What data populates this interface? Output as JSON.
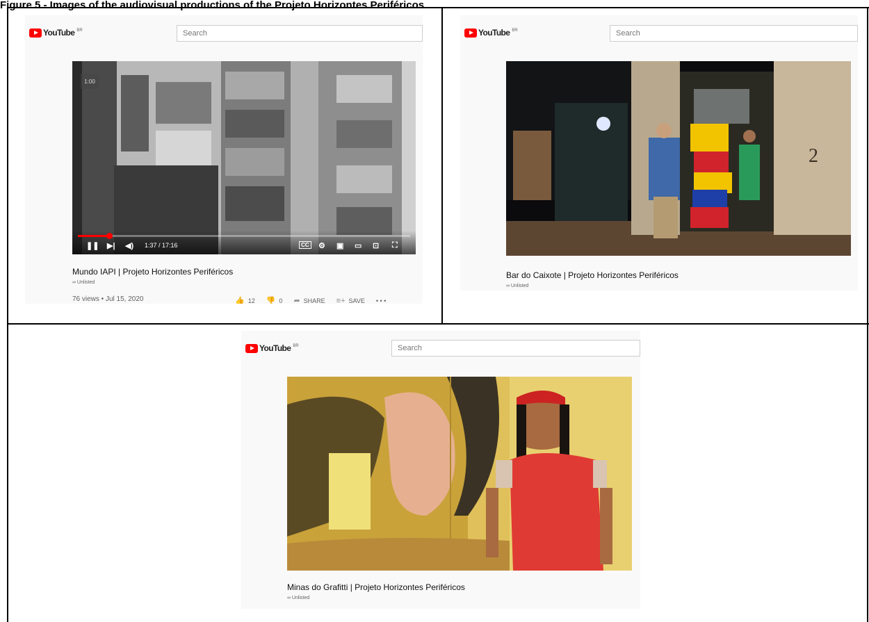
{
  "figure_label": "Figure 5 - Images of the audiovisual productions of the Projeto Horizontes Periféricos",
  "youtube": {
    "logo_text": "YouTube",
    "region": "BR",
    "search_placeholder": "Search",
    "brand_color": "#ff0000"
  },
  "videos": [
    {
      "title": "Mundo IAPI | Projeto Horizontes Periféricos",
      "badge": "∞ Unlisted",
      "views_date": "76 views • Jul 15, 2020",
      "player": {
        "overlay_time": "1:00",
        "current_time": "1:37",
        "duration": "17:16",
        "time_display": "1:37 / 17:16",
        "progress_fraction": 0.094
      },
      "actions": {
        "likes": "12",
        "dislikes": "0",
        "share": "SHARE",
        "save": "SAVE",
        "more": "• • •"
      }
    },
    {
      "title": "Bar do Caixote | Projeto Horizontes Periféricos",
      "badge": "∞ Unlisted"
    },
    {
      "title": "Minas do Grafitti | Projeto Horizontes Periféricos",
      "badge": "∞ Unlisted"
    }
  ]
}
